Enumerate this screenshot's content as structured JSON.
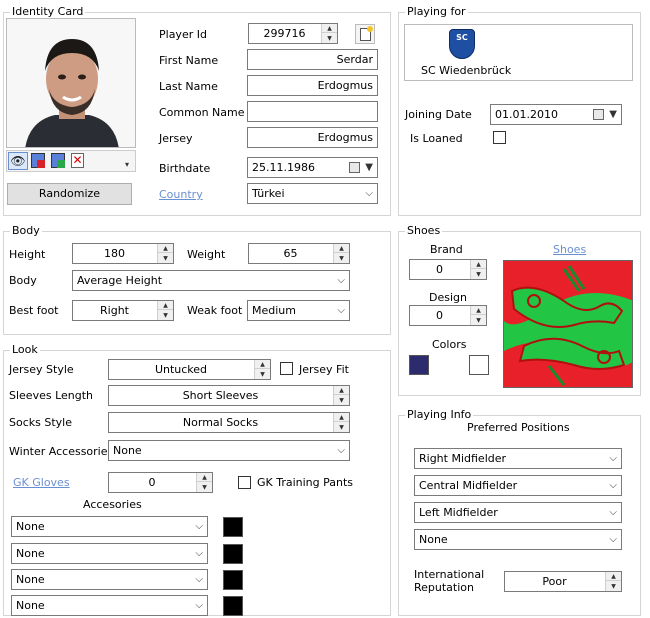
{
  "identity": {
    "title": "Identity Card",
    "player_id_label": "Player Id",
    "player_id": "299716",
    "first_name_label": "First Name",
    "first_name": "Serdar",
    "last_name_label": "Last Name",
    "last_name": "Erdogmus",
    "common_name_label": "Common Name",
    "common_name": "",
    "jersey_label": "Jersey",
    "jersey": "Erdogmus",
    "birthdate_label": "Birthdate",
    "birthdate": "25.11.1986",
    "country_label": "Country",
    "country": "Türkei",
    "randomize_label": "Randomize"
  },
  "playing_for": {
    "title": "Playing for",
    "club_name": "SC Wiedenbrück",
    "club_logo_text": "SC",
    "joining_date_label": "Joining Date",
    "joining_date": "01.01.2010",
    "is_loaned_label": "Is Loaned"
  },
  "body": {
    "title": "Body",
    "height_label": "Height",
    "height": "180",
    "weight_label": "Weight",
    "weight": "65",
    "body_label": "Body",
    "body_type": "Average Height",
    "best_foot_label": "Best foot",
    "best_foot": "Right",
    "weak_foot_label": "Weak foot",
    "weak_foot": "Medium"
  },
  "shoes": {
    "title": "Shoes",
    "brand_label": "Brand",
    "brand": "0",
    "design_label": "Design",
    "design": "0",
    "colors_label": "Colors",
    "shoes_link": "Shoes",
    "color1": "#2b2b6e",
    "color2": "#ffffff"
  },
  "look": {
    "title": "Look",
    "jersey_style_label": "Jersey Style",
    "jersey_style": "Untucked",
    "jersey_fit_label": "Jersey Fit",
    "sleeves_label": "Sleeves Length",
    "sleeves": "Short Sleeves",
    "socks_label": "Socks Style",
    "socks": "Normal Socks",
    "winter_label": "Winter Accessories",
    "winter": "None",
    "gk_gloves_label": "GK Gloves",
    "gk_gloves": "0",
    "gk_training_label": "GK Training Pants",
    "accessories_label": "Accesories",
    "accessories": [
      "None",
      "None",
      "None",
      "None"
    ]
  },
  "playing_info": {
    "title": "Playing Info",
    "preferred_label": "Preferred Positions",
    "positions": [
      "Right Midfielder",
      "Central Midfielder",
      "Left Midfielder",
      "None"
    ],
    "intl_label_1": "International",
    "intl_label_2": "Reputation",
    "intl_value": "Poor"
  }
}
